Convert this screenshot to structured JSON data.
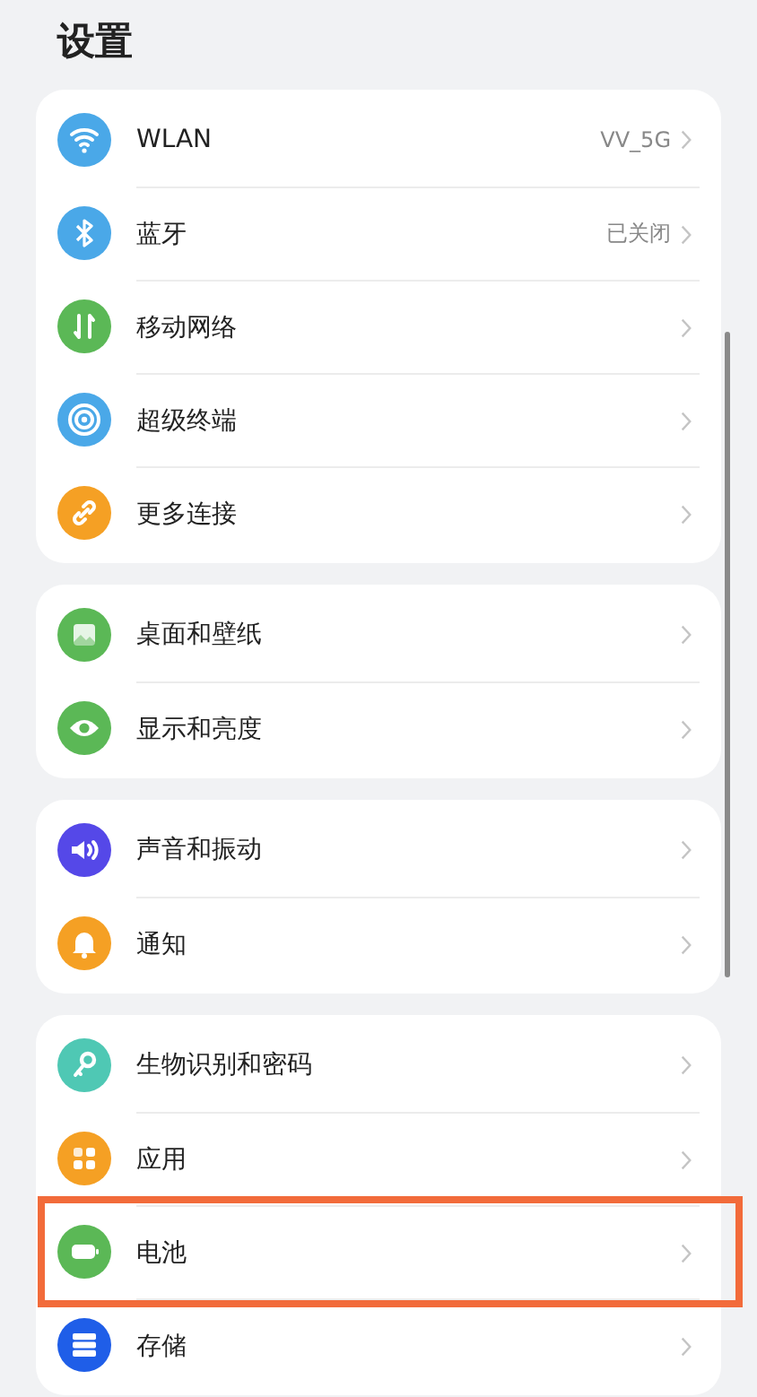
{
  "title": "设置",
  "groups": [
    {
      "items": [
        {
          "label": "WLAN",
          "value": "VV_5G",
          "color": "#4aa8e8",
          "highlighted": false
        },
        {
          "label": "蓝牙",
          "value": "已关闭",
          "color": "#4aa8e8",
          "highlighted": false
        },
        {
          "label": "移动网络",
          "color": "#5bb856",
          "highlighted": false
        },
        {
          "label": "超级终端",
          "color": "#4aa8e8",
          "highlighted": false
        },
        {
          "label": "更多连接",
          "color": "#f5a024",
          "highlighted": false
        }
      ]
    },
    {
      "items": [
        {
          "label": "桌面和壁纸",
          "color": "#5bb856",
          "highlighted": false
        },
        {
          "label": "显示和亮度",
          "color": "#5bb856",
          "highlighted": false
        }
      ]
    },
    {
      "items": [
        {
          "label": "声音和振动",
          "color": "#5548e8",
          "highlighted": false
        },
        {
          "label": "通知",
          "color": "#f5a024",
          "highlighted": false
        }
      ]
    },
    {
      "items": [
        {
          "label": "生物识别和密码",
          "color": "#4fc8b4",
          "highlighted": false
        },
        {
          "label": "应用",
          "color": "#f5a024",
          "highlighted": false
        },
        {
          "label": "电池",
          "color": "#5bb856",
          "highlighted": true
        },
        {
          "label": "存储",
          "color": "#1f5ee8",
          "highlighted": false
        }
      ]
    }
  ]
}
